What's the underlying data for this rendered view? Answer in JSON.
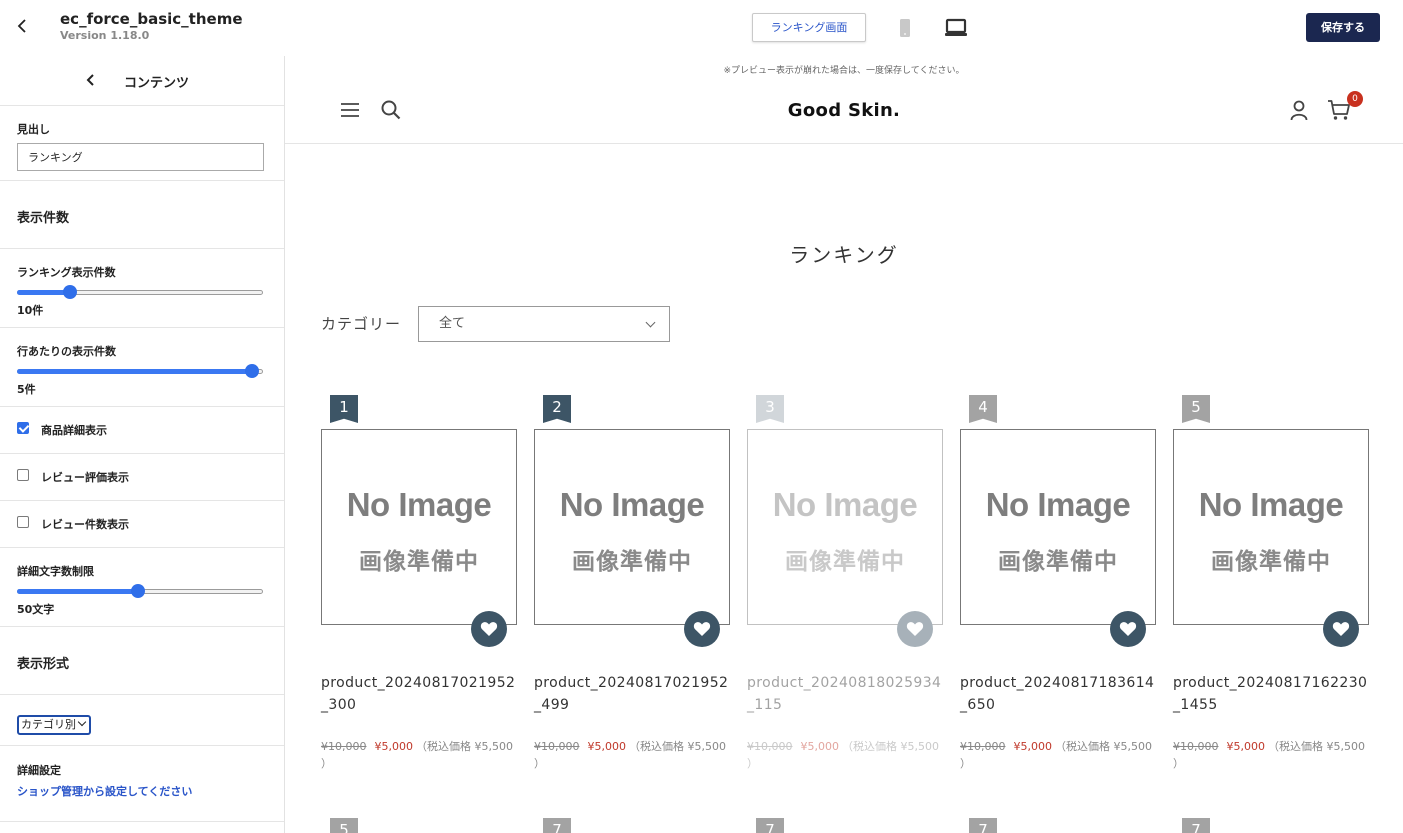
{
  "app": {
    "title": "ec_force_basic_theme",
    "version": "Version 1.18.0",
    "page_select": "ランキング画面",
    "save_label": "保存する"
  },
  "sidebar": {
    "title": "コンテンツ",
    "heading_label": "見出し",
    "heading_value": "ランキング",
    "count_section": "表示件数",
    "ranking_count": {
      "label": "ランキング表示件数",
      "value": "10件",
      "level": 0.2
    },
    "per_row": {
      "label": "行あたりの表示件数",
      "value": "5件",
      "level": 1.0
    },
    "checkboxes": [
      {
        "label": "商品詳細表示",
        "checked": true
      },
      {
        "label": "レビュー評価表示",
        "checked": false
      },
      {
        "label": "レビュー件数表示",
        "checked": false
      }
    ],
    "detail_limit": {
      "label": "詳細文字数制限",
      "value": "50文字",
      "level": 0.5
    },
    "format_section": "表示形式",
    "format_value": "カテゴリ別",
    "advanced_label": "詳細設定",
    "advanced_link": "ショップ管理から設定してください"
  },
  "preview": {
    "note": "※プレビュー表示が崩れた場合は、一度保存してください。",
    "logo": "Good Skin.",
    "cart_count": "0",
    "section_title": "ランキング",
    "category_label": "カテゴリー",
    "category_value": "全て",
    "no_image_main": "No Image",
    "no_image_sub": "画像準備中",
    "products": [
      {
        "rank": "1",
        "name": "product_20240817021952_300",
        "list_price": "¥10,000",
        "sale_price": "¥5,000",
        "tax_note": "（税込価格 ¥5,500 ）",
        "badge_color": "#3d5566",
        "faded": false
      },
      {
        "rank": "2",
        "name": "product_20240817021952_499",
        "list_price": "¥10,000",
        "sale_price": "¥5,000",
        "tax_note": "（税込価格 ¥5,500 ）",
        "badge_color": "#3d5566",
        "faded": false
      },
      {
        "rank": "3",
        "name": "product_20240818025934_115",
        "list_price": "¥10,000",
        "sale_price": "¥5,000",
        "tax_note": "（税込価格 ¥5,500 ）",
        "badge_color": "#9aa6ae",
        "faded": true
      },
      {
        "rank": "4",
        "name": "product_20240817183614_650",
        "list_price": "¥10,000",
        "sale_price": "¥5,000",
        "tax_note": "（税込価格 ¥5,500 ）",
        "badge_color": "#a3a3a3",
        "faded": false
      },
      {
        "rank": "5",
        "name": "product_20240817162230_1455",
        "list_price": "¥10,000",
        "sale_price": "¥5,000",
        "tax_note": "（税込価格 ¥5,500 ）",
        "badge_color": "#a3a3a3",
        "faded": false
      }
    ],
    "next_row_ranks": [
      "5",
      "7",
      "7",
      "7",
      "7"
    ]
  },
  "colors": {
    "accent": "#2f6ee9",
    "save_button": "#1b2750",
    "badge_top": "#3d5566",
    "sale": "#c0392b"
  }
}
